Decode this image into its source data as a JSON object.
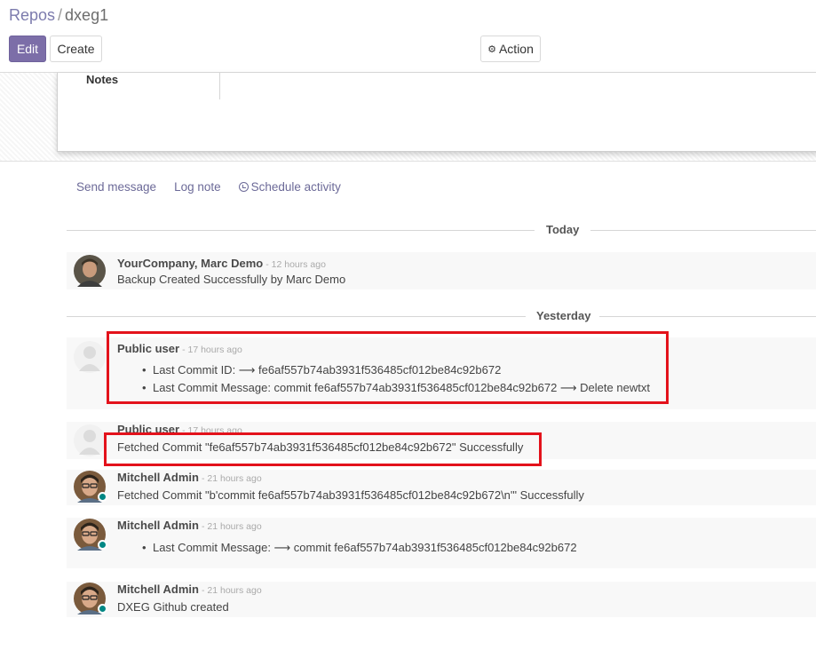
{
  "breadcrumb": {
    "parent": "Repos",
    "separator": "/",
    "current": "dxeg1"
  },
  "buttons": {
    "edit": "Edit",
    "create": "Create",
    "action": "Action"
  },
  "sheet": {
    "notes_label": "Notes"
  },
  "chatter": {
    "send_message": "Send message",
    "log_note": "Log note",
    "schedule_activity": "Schedule activity"
  },
  "separators": {
    "today": "Today",
    "yesterday": "Yesterday"
  },
  "messages": [
    {
      "author": "YourCompany, Marc Demo",
      "date": "- 12 hours ago",
      "body": "Backup Created Successfully by Marc Demo"
    },
    {
      "author": "Public user",
      "date": "- 17 hours ago",
      "bullets": [
        "Last Commit ID: ⟶ fe6af557b74ab3931f536485cf012be84c92b672",
        "Last Commit Message: commit fe6af557b74ab3931f536485cf012be84c92b672 ⟶ Delete newtxt"
      ]
    },
    {
      "author": "Public user",
      "date": "- 17 hours ago",
      "body": "Fetched Commit \"fe6af557b74ab3931f536485cf012be84c92b672\" Successfully"
    },
    {
      "author": "Mitchell Admin",
      "date": "- 21 hours ago",
      "body": "Fetched Commit \"b'commit fe6af557b74ab3931f536485cf012be84c92b672\\n'\" Successfully"
    },
    {
      "author": "Mitchell Admin",
      "date": "- 21 hours ago",
      "bullets": [
        "Last Commit Message: ⟶ commit fe6af557b74ab3931f536485cf012be84c92b672"
      ]
    },
    {
      "author": "Mitchell Admin",
      "date": "- 21 hours ago",
      "body": "DXEG Github created"
    }
  ],
  "colors": {
    "accent": "#7c6ea8",
    "highlight": "#e3121b",
    "online": "#008784",
    "link": "#6c6a98"
  }
}
